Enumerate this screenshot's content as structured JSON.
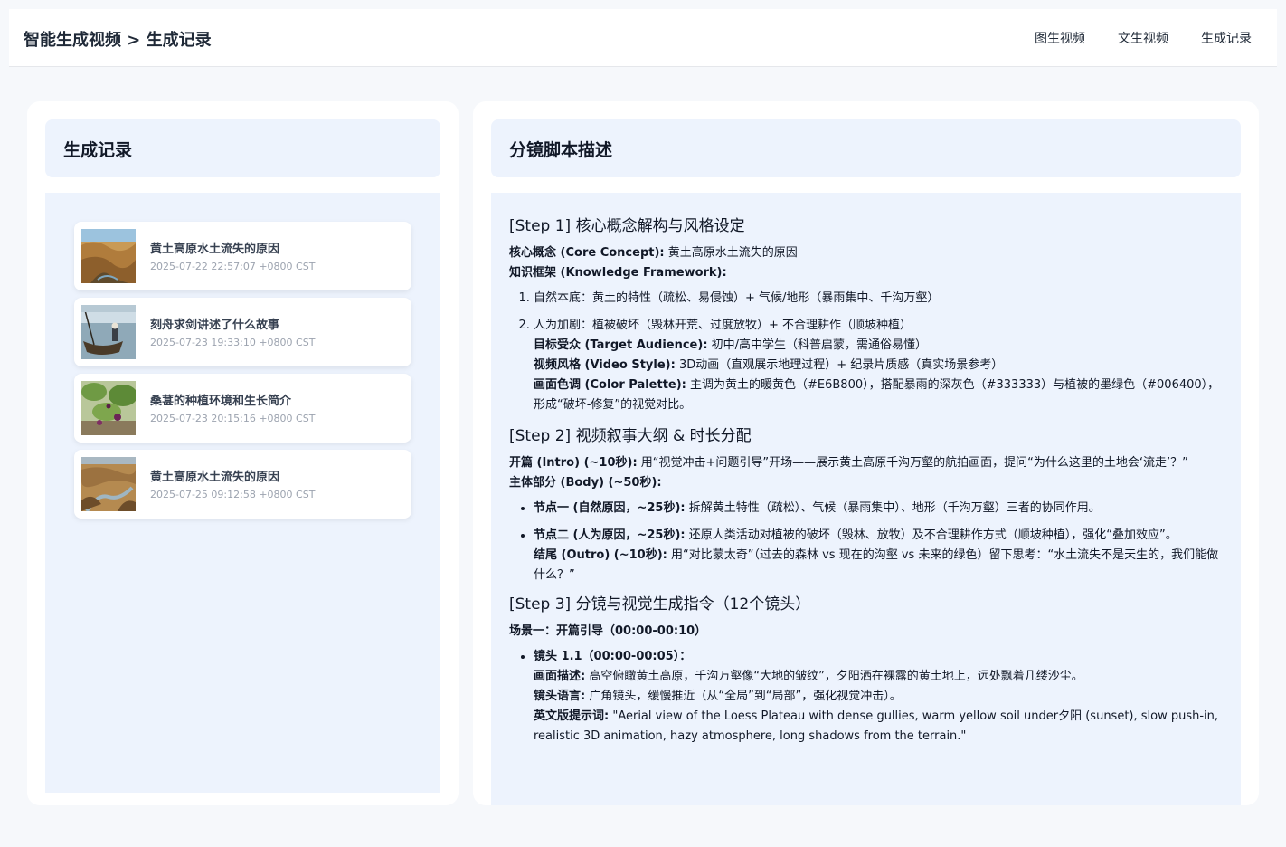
{
  "header": {
    "breadcrumb": "智能生成视频 > 生成记录",
    "nav": [
      "图生视频",
      "文生视频",
      "生成记录"
    ]
  },
  "left_panel": {
    "title": "生成记录",
    "records": [
      {
        "title": "黄土高原水土流失的原因",
        "time": "2025-07-22 22:57:07 +0800 CST",
        "thumb": "loess-landscape-image"
      },
      {
        "title": "刻舟求剑讲述了什么故事",
        "time": "2025-07-23 19:33:10 +0800 CST",
        "thumb": "boat-on-river-image"
      },
      {
        "title": "桑葚的种植环境和生长简介",
        "time": "2025-07-23 20:15:16 +0800 CST",
        "thumb": "mulberry-bush-image"
      },
      {
        "title": "黄土高原水土流失的原因",
        "time": "2025-07-25 09:12:58 +0800 CST",
        "thumb": "gully-river-image"
      }
    ]
  },
  "right_panel": {
    "title": "分镜脚本描述",
    "step1": {
      "heading": "[Step 1] 核心概念解构与风格设定",
      "core_label": "核心概念 (Core Concept):",
      "core_value": " 黄土高原水土流失的原因",
      "framework_label": "知识框架 (Knowledge Framework):",
      "item1": "自然本底：黄土的特性（疏松、易侵蚀）+ 气候/地形（暴雨集中、千沟万壑）",
      "item2": "人为加剧：植被破坏（毁林开荒、过度放牧）+ 不合理耕作（顺坡种植）",
      "audience_label": "目标受众 (Target Audience):",
      "audience_value": " 初中/高中学生（科普启蒙，需通俗易懂）",
      "style_label": "视频风格 (Video Style):",
      "style_value": " 3D动画（直观展示地理过程）+ 纪录片质感（真实场景参考）",
      "palette_label": "画面色调 (Color Palette):",
      "palette_value": " 主调为黄土的暖黄色（#E6B800），搭配暴雨的深灰色（#333333）与植被的墨绿色（#006400），形成“破坏-修复”的视觉对比。"
    },
    "step2": {
      "heading": "[Step 2] 视频叙事大纲 & 时长分配",
      "intro_label": "开篇 (Intro) (~10秒):",
      "intro_value": " 用“视觉冲击+问题引导”开场——展示黄土高原千沟万壑的航拍画面，提问“为什么这里的土地会‘流走’？”",
      "body_label": "主体部分 (Body) (~50秒):",
      "node1_label": "节点一 (自然原因，~25秒):",
      "node1_value": " 拆解黄土特性（疏松）、气候（暴雨集中）、地形（千沟万壑）三者的协同作用。",
      "node2_label": "节点二 (人为原因，~25秒):",
      "node2_value": " 还原人类活动对植被的破坏（毁林、放牧）及不合理耕作方式（顺坡种植），强化“叠加效应”。",
      "outro_label": "结尾 (Outro) (~10秒):",
      "outro_value": " 用“对比蒙太奇”（过去的森林 vs 现在的沟壑 vs 未来的绿色）留下思考：“水土流失不是天生的，我们能做什么？”"
    },
    "step3": {
      "heading": "[Step 3] 分镜与视觉生成指令（12个镜头）",
      "scene1": "场景一：开篇引导（00:00-00:10）",
      "shot_label": "镜头 1.1（00:00-00:05）：",
      "desc_label": "画面描述:",
      "desc_value": " 高空俯瞰黄土高原，千沟万壑像“大地的皱纹”，夕阳洒在裸露的黄土地上，远处飘着几缕沙尘。",
      "lang_label": "镜头语言:",
      "lang_value": " 广角镜头，缓慢推近（从“全局”到“局部”，强化视觉冲击）。",
      "en_label": "英文版提示词:",
      "en_value": " \"Aerial view of the Loess Plateau with dense gullies, warm yellow soil under夕阳 (sunset), slow push-in, realistic 3D animation, hazy atmosphere, long shadows from the terrain.\""
    }
  }
}
